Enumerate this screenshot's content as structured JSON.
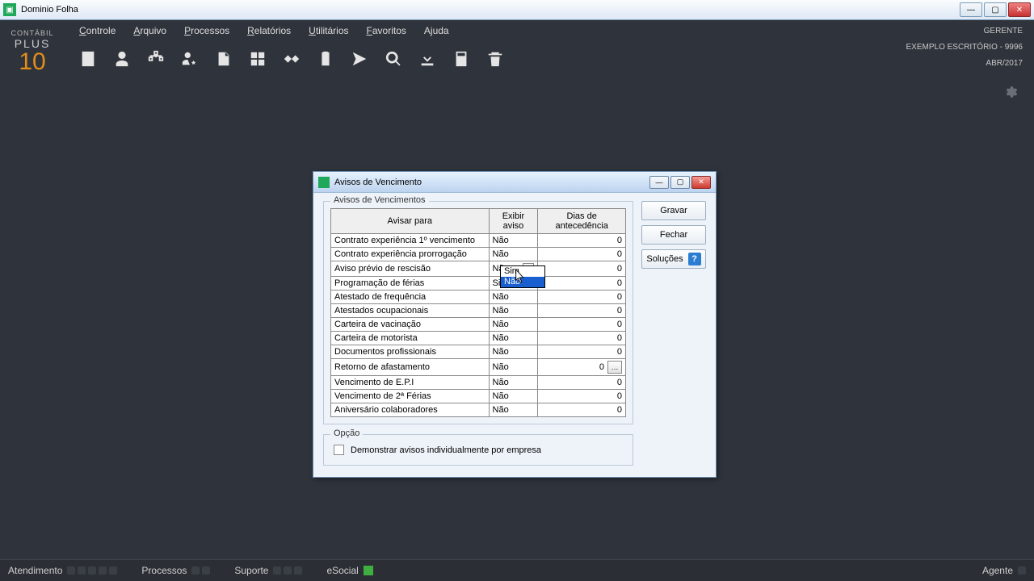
{
  "window": {
    "title": "Dominio Folha"
  },
  "logo": {
    "line1": "CONTÁBIL",
    "line2": "PLUS",
    "line3": "10"
  },
  "menu": {
    "controle": "Controle",
    "arquivo": "Arquivo",
    "processos": "Processos",
    "relatorios": "Relatórios",
    "utilitarios": "Utilitários",
    "favoritos": "Favoritos",
    "ajuda": "Ajuda"
  },
  "header_info": {
    "role": "GERENTE",
    "company": "EXEMPLO ESCRITÓRIO  - 9996",
    "period": "ABR/2017"
  },
  "dialog": {
    "title": "Avisos de Vencimento",
    "group_label": "Avisos de Vencimentos",
    "columns": {
      "c1": "Avisar para",
      "c2": "Exibir aviso",
      "c3": "Dias de antecedência"
    },
    "rows": [
      {
        "label": "Contrato experiência 1º vencimento",
        "aviso": "Não",
        "dias": "0"
      },
      {
        "label": "Contrato experiência prorrogação",
        "aviso": "Não",
        "dias": "0"
      },
      {
        "label": "Aviso prévio de rescisão",
        "aviso": "Não",
        "dias": "0",
        "dropdown": true
      },
      {
        "label": "Programação de férias",
        "aviso": "Sim",
        "dias": "0"
      },
      {
        "label": "Atestado de frequência",
        "aviso": "Não",
        "dias": "0"
      },
      {
        "label": "Atestados ocupacionais",
        "aviso": "Não",
        "dias": "0"
      },
      {
        "label": "Carteira de vacinação",
        "aviso": "Não",
        "dias": "0"
      },
      {
        "label": "Carteira de motorista",
        "aviso": "Não",
        "dias": "0"
      },
      {
        "label": "Documentos profissionais",
        "aviso": "Não",
        "dias": "0"
      },
      {
        "label": "Retorno de afastamento",
        "aviso": "Não",
        "dias": "0",
        "dots": true
      },
      {
        "label": "Vencimento de E.P.I",
        "aviso": "Não",
        "dias": "0"
      },
      {
        "label": "Vencimento de 2ª Férias",
        "aviso": "Não",
        "dias": "0"
      },
      {
        "label": "Aniversário colaboradores",
        "aviso": "Não",
        "dias": "0"
      }
    ],
    "dropdown_options": {
      "o1": "Sim",
      "o2": "Não"
    },
    "opt_group": "Opção",
    "opt_check": "Demonstrar avisos individualmente por empresa",
    "buttons": {
      "save": "Gravar",
      "close": "Fechar",
      "solutions": "Soluções"
    }
  },
  "statusbar": {
    "atendimento": "Atendimento",
    "processos": "Processos",
    "suporte": "Suporte",
    "esocial": "eSocial",
    "agente": "Agente"
  }
}
